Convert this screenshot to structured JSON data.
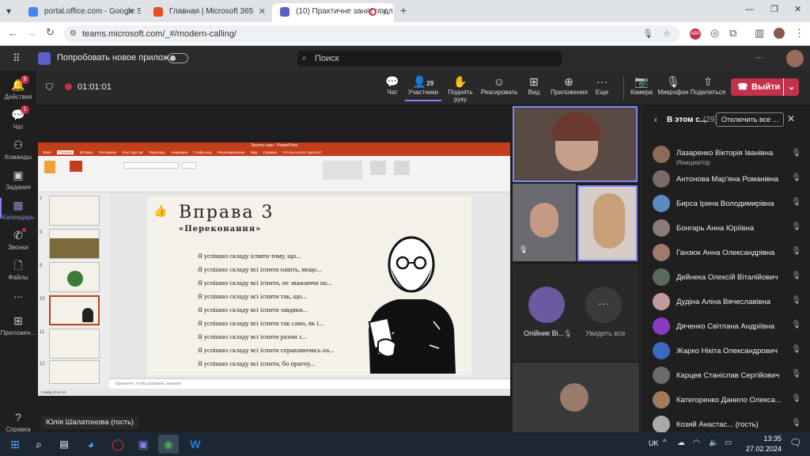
{
  "browser": {
    "tabs": [
      {
        "title": "portal.office.com - Google Sear",
        "fav_color": "#4285f4"
      },
      {
        "title": "Главная | Microsoft 365",
        "fav_color": "#e44d26"
      },
      {
        "title": "(10) Практичне заняття дл",
        "fav_color": "#5b5fc7"
      }
    ],
    "new_tab": "+",
    "url": "teams.microsoft.com/_#/modern-calling/"
  },
  "teams": {
    "try_new": "Попробовать новое прилож...",
    "search_placeholder": "Поиск"
  },
  "rail": [
    {
      "label": "Действия",
      "badge": "9",
      "icon": "bell-icon"
    },
    {
      "label": "Чат",
      "badge": "1",
      "icon": "chat-icon"
    },
    {
      "label": "Команды",
      "badge": "",
      "icon": "teams-icon"
    },
    {
      "label": "Задания",
      "badge": "",
      "icon": "assignments-icon"
    },
    {
      "label": "Календарь",
      "badge": "",
      "icon": "calendar-icon"
    },
    {
      "label": "Звонки",
      "badge": "",
      "icon": "calls-icon"
    },
    {
      "label": "Файлы",
      "badge": "",
      "icon": "files-icon"
    },
    {
      "label": "...",
      "badge": "",
      "icon": "more-icon"
    },
    {
      "label": "Приложен...",
      "badge": "",
      "icon": "apps-icon"
    },
    {
      "label": "Справка",
      "badge": "",
      "icon": "help-icon"
    }
  ],
  "meeting": {
    "timer": "01:01:01",
    "participant_count": "29",
    "buttons": [
      "Чат",
      "Участники",
      "Поднять руку",
      "Реагировать",
      "Вид",
      "Приложения",
      "Еще",
      "Камера",
      "Микрофон",
      "Поделиться"
    ],
    "leave": "Выйти"
  },
  "presenter_name": "Юлія Шалатонова (гость)",
  "ppt": {
    "title": "Тролло серо - PowerPoint",
    "tabs": [
      "Файл",
      "Главная",
      "Вставка",
      "Рисование",
      "Конструктор",
      "Переходы",
      "Анимация",
      "Слайд-шоу",
      "Рецензирование",
      "Вид",
      "Справка",
      "Что вы хотите сделать?"
    ],
    "notes": "Щелкните, чтобы добавить заметки",
    "status": "Слайд 10 из 11",
    "slide_title": "Вправа 3",
    "slide_subtitle": "«Переконання»",
    "lines": [
      "Я успішно складу іспити тому, що...",
      "Я успішно складу всі іспити навіть, якщо...",
      "Я успішно складу всі іспити, не зважаючи на...",
      "Я успішно складу всі іспити так, що...",
      "Я успішно складу всі іспити завдяки...",
      "Я успішно складу всі іспити так само, як і...",
      "Я успішно складу всі іспити разом з...",
      "Я успішно складу всі іспити справляючись на...",
      "Я успішно складу всі іспити, бо прагну..."
    ],
    "thumb_numbers": [
      "7",
      "8",
      "9",
      "10",
      "11",
      "12"
    ]
  },
  "videos": {
    "tile_name": "Олійник Ві...",
    "see_all": "Увидеть все"
  },
  "panel": {
    "title": "В этом с...",
    "count": "(29)",
    "mute_all": "Отключить все ...",
    "participants": [
      {
        "name": "Лазаренко Вікторія Іванівна",
        "sub": "Инициатор",
        "color": "#8a6a5a"
      },
      {
        "name": "Антонова Мар'яна Романівна",
        "sub": "",
        "color": "#7a6a6a"
      },
      {
        "name": "Бирса Ірина Володимирівна",
        "sub": "",
        "color": "#5a8ac0"
      },
      {
        "name": "Бонгарь Анна Юріївна",
        "sub": "",
        "color": "#8a7a7a"
      },
      {
        "name": "Ганзюк Анна Олександрівна",
        "sub": "",
        "color": "#a07a6a"
      },
      {
        "name": "Дейнека Олексій Віталійович",
        "sub": "",
        "color": "#5a6a5a"
      },
      {
        "name": "Дудіна Аліна Вячеславівна",
        "sub": "",
        "color": "#c09aa0"
      },
      {
        "name": "Дяченко Світлана Андріївна",
        "sub": "",
        "color": "#8a3ac0"
      },
      {
        "name": "Жарко Нікіта Олександрович",
        "sub": "",
        "color": "#3a6ac0"
      },
      {
        "name": "Карцев Станіслав Сергійович",
        "sub": "",
        "color": "#6a6a6a"
      },
      {
        "name": "Категоренко Данило Олекса...",
        "sub": "",
        "color": "#a07a5a"
      },
      {
        "name": "Козий Анастас... (гость)",
        "sub": "",
        "color": "#aaa"
      }
    ]
  },
  "taskbar": {
    "lang": "UK",
    "time": "13:35",
    "date": "27.02.2024"
  }
}
